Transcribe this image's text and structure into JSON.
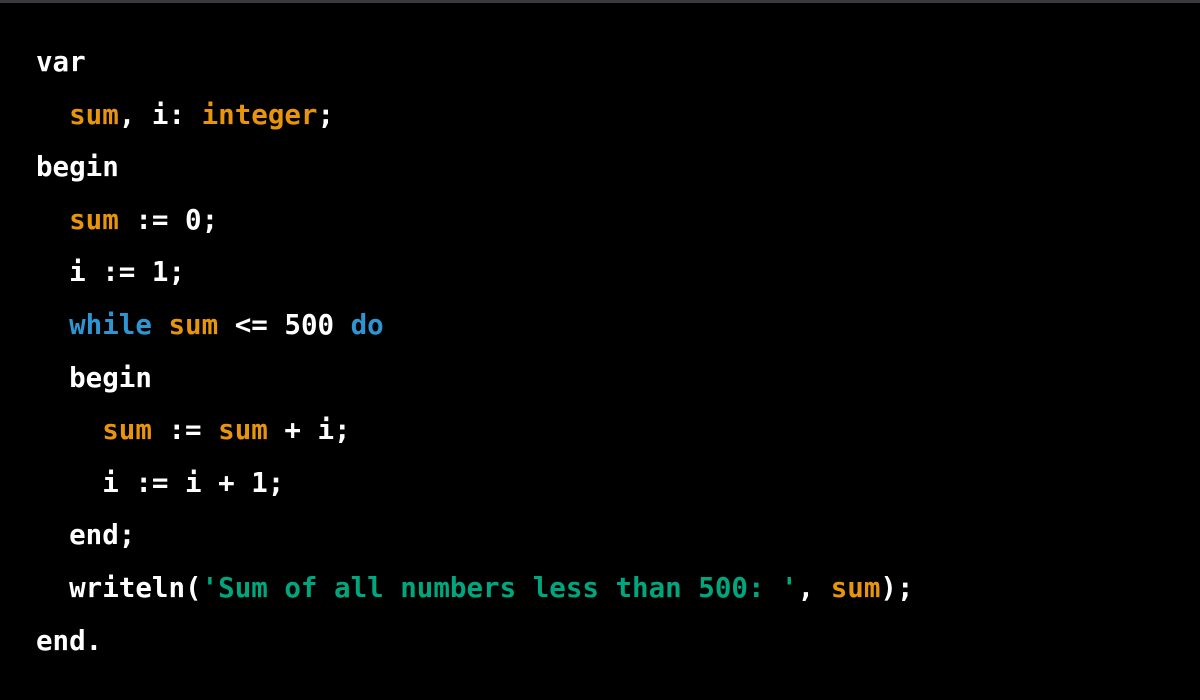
{
  "code": {
    "language": "pascal",
    "colors": {
      "keyword": "#ffffff",
      "identifier": "#e9950c",
      "control": "#2e95d3",
      "string": "#00a67d",
      "plain": "#ffffff"
    },
    "lines": [
      [
        [
          "kw",
          "var"
        ]
      ],
      [
        [
          "plain",
          "  "
        ],
        [
          "var",
          "sum"
        ],
        [
          "plain",
          ", i: "
        ],
        [
          "var",
          "integer"
        ],
        [
          "plain",
          ";"
        ]
      ],
      [
        [
          "kw",
          "begin"
        ]
      ],
      [
        [
          "plain",
          "  "
        ],
        [
          "var",
          "sum"
        ],
        [
          "plain",
          " := 0;"
        ]
      ],
      [
        [
          "plain",
          "  i := 1;"
        ]
      ],
      [
        [
          "plain",
          "  "
        ],
        [
          "blue",
          "while"
        ],
        [
          "plain",
          " "
        ],
        [
          "var",
          "sum"
        ],
        [
          "plain",
          " <= 500 "
        ],
        [
          "blue",
          "do"
        ]
      ],
      [
        [
          "plain",
          "  begin"
        ]
      ],
      [
        [
          "plain",
          "    "
        ],
        [
          "var",
          "sum"
        ],
        [
          "plain",
          " := "
        ],
        [
          "var",
          "sum"
        ],
        [
          "plain",
          " + i;"
        ]
      ],
      [
        [
          "plain",
          "    i := i + 1;"
        ]
      ],
      [
        [
          "plain",
          "  end;"
        ]
      ],
      [
        [
          "plain",
          "  writeln("
        ],
        [
          "str",
          "'Sum of all numbers less than 500: '"
        ],
        [
          "plain",
          ", "
        ],
        [
          "var",
          "sum"
        ],
        [
          "plain",
          ");"
        ]
      ],
      [
        [
          "kw",
          "end."
        ]
      ]
    ]
  }
}
